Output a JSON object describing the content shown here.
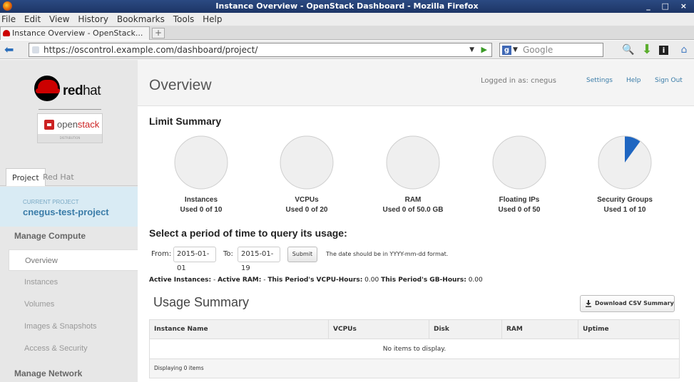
{
  "window": {
    "title": "Instance Overview - OpenStack Dashboard - Mozilla Firefox",
    "controls": "_ □ ×"
  },
  "menu": [
    "File",
    "Edit",
    "View",
    "History",
    "Bookmarks",
    "Tools",
    "Help"
  ],
  "tab": {
    "title": "Instance Overview - OpenStack...",
    "new_tab": "+"
  },
  "nav": {
    "url": "https://oscontrol.example.com/dashboard/project/",
    "search_placeholder": "Google",
    "search_engine": "g"
  },
  "sidebar": {
    "logo_word_bold": "red",
    "logo_word_light": "hat",
    "os_logo_a": "open",
    "os_logo_b": "stack",
    "os_logo_band": "DISTRIBUTION",
    "tabs": [
      "Project",
      "Red Hat"
    ],
    "current_project_label": "CURRENT PROJECT",
    "current_project": "cnegus-test-project",
    "section_compute": "Manage Compute",
    "items": [
      "Overview",
      "Instances",
      "Volumes",
      "Images & Snapshots",
      "Access & Security"
    ],
    "section_network": "Manage Network"
  },
  "header": {
    "title": "Overview",
    "logged_in": "Logged in as: cnegus",
    "settings": "Settings",
    "help": "Help",
    "sign_out": "Sign Out"
  },
  "limits": {
    "title": "Limit Summary",
    "items": [
      {
        "name": "Instances",
        "usage": "Used 0 of 10",
        "fraction": 0
      },
      {
        "name": "VCPUs",
        "usage": "Used 0 of 20",
        "fraction": 0
      },
      {
        "name": "RAM",
        "usage": "Used 0 of 50.0 GB",
        "fraction": 0
      },
      {
        "name": "Floating IPs",
        "usage": "Used 0 of 50",
        "fraction": 0
      },
      {
        "name": "Security Groups",
        "usage": "Used 1 of 10",
        "fraction": 0.1
      }
    ],
    "pie_bg": "#efefef",
    "pie_fill": "#1f66c1"
  },
  "query": {
    "title": "Select a period of time to query its usage:",
    "from_label": "From:",
    "from_value": "2015-01-01",
    "to_label": "To:",
    "to_value": "2015-01-19",
    "submit": "Submit",
    "hint": "The date should be in YYYY-mm-dd format."
  },
  "active": {
    "instances_label": "Active Instances:",
    "instances_value": "-",
    "ram_label": "Active RAM:",
    "ram_value": "-",
    "vcpu_label": "This Period's VCPU-Hours:",
    "vcpu_value": "0.00",
    "gb_label": "This Period's GB-Hours:",
    "gb_value": "0.00"
  },
  "usage": {
    "title": "Usage Summary",
    "csv_button": "Download CSV Summary",
    "columns": [
      "Instance Name",
      "VCPUs",
      "Disk",
      "RAM",
      "Uptime"
    ],
    "empty": "No items to display.",
    "footer": "Displaying 0 items"
  }
}
